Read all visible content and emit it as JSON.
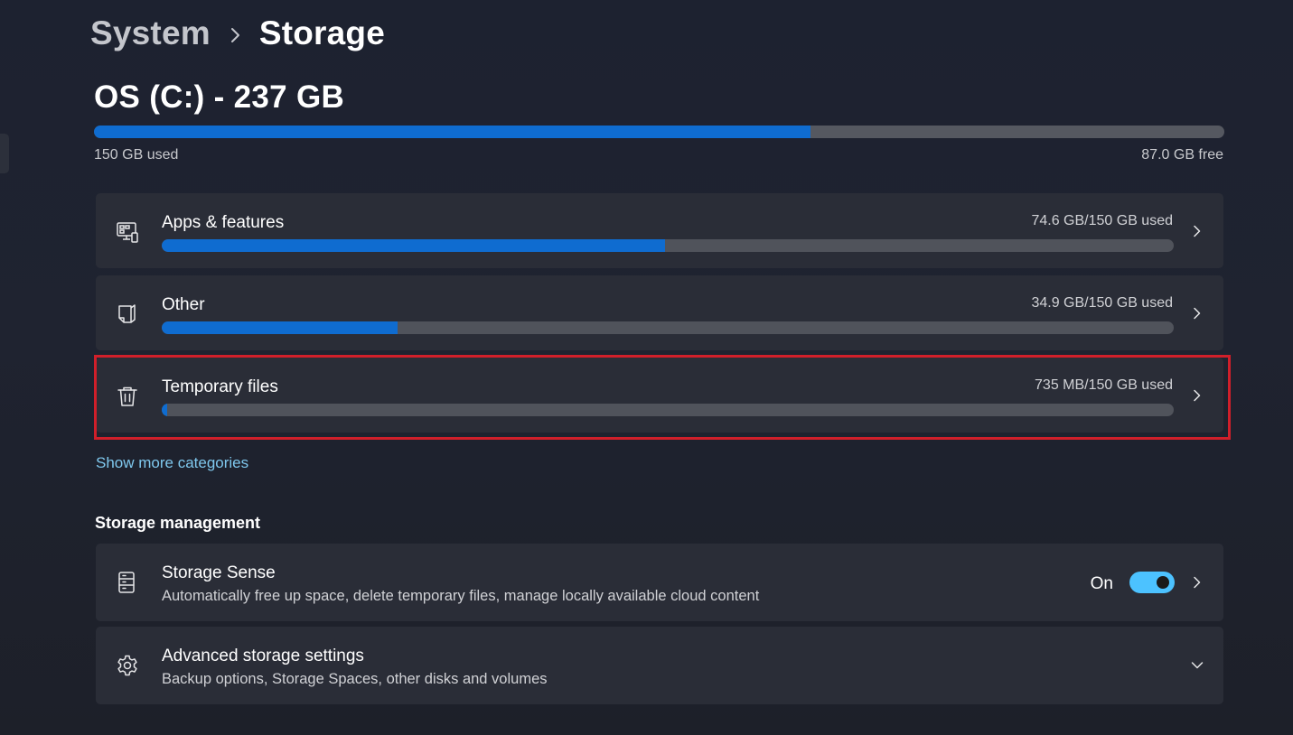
{
  "breadcrumb": {
    "parent": "System",
    "current": "Storage"
  },
  "drive": {
    "title": "OS (C:) - 237 GB",
    "used_label": "150 GB used",
    "free_label": "87.0 GB free",
    "used_fraction": 0.634
  },
  "categories": [
    {
      "label": "Apps & features",
      "usage": "74.6 GB/150 GB used",
      "fraction": 0.497,
      "icon": "apps-features-icon"
    },
    {
      "label": "Other",
      "usage": "34.9 GB/150 GB used",
      "fraction": 0.233,
      "icon": "document-icon"
    },
    {
      "label": "Temporary files",
      "usage": "735 MB/150 GB used",
      "fraction": 0.005,
      "icon": "trash-icon",
      "highlighted": true
    }
  ],
  "show_more": "Show more categories",
  "storage_management": {
    "header": "Storage management",
    "items": [
      {
        "label": "Storage Sense",
        "description": "Automatically free up space, delete temporary files, manage locally available cloud content",
        "toggle_label": "On",
        "toggle_on": true,
        "icon": "storage-sense-icon"
      },
      {
        "label": "Advanced storage settings",
        "description": "Backup options, Storage Spaces, other disks and volumes",
        "icon": "gear-icon"
      }
    ]
  },
  "colors": {
    "accent": "#0f6cd0",
    "toggle": "#4cc2ff",
    "link": "#7fc8ee",
    "highlight": "#d01f2a"
  }
}
